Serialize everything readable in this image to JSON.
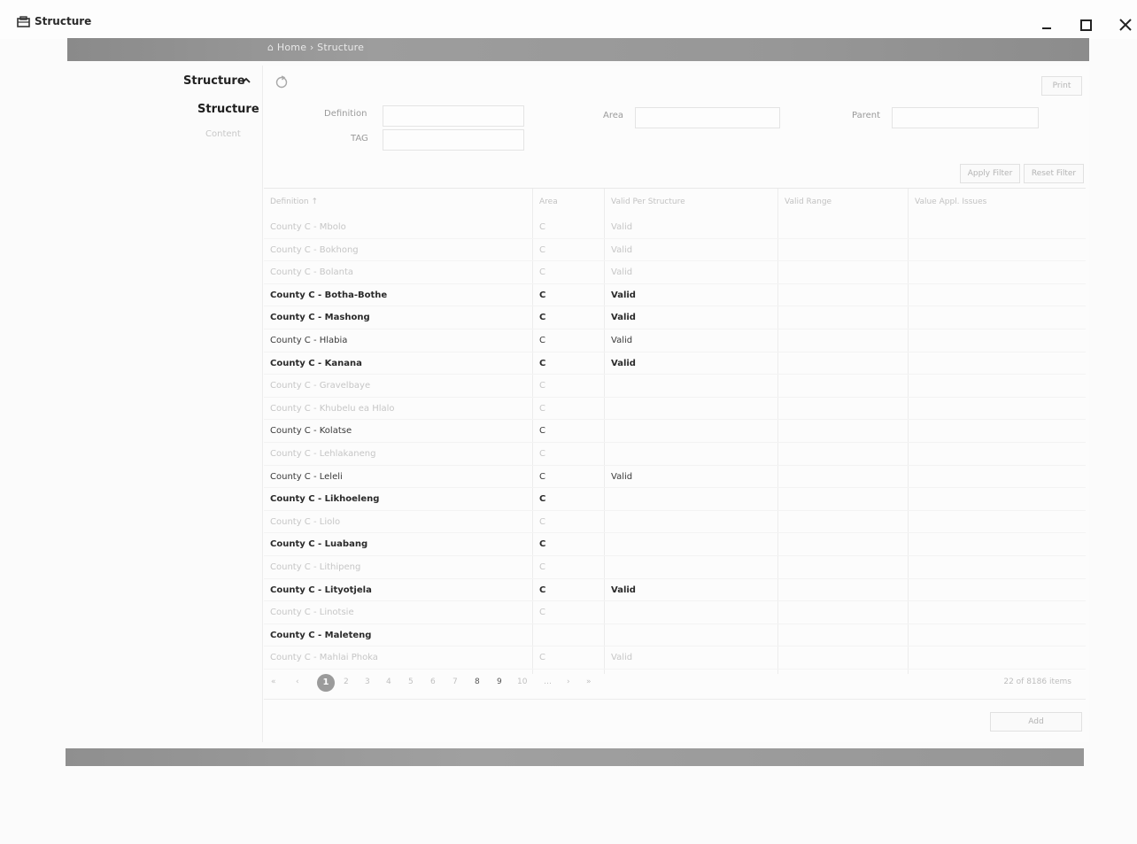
{
  "window": {
    "title": "Structure",
    "minimize_glyph": "–",
    "maximize_glyph": "□",
    "close_glyph": "✕"
  },
  "breadcrumb": "⌂ Home › Structure",
  "sidebar": {
    "section_label": "Structure",
    "items": [
      {
        "label": "Structure",
        "active": true
      },
      {
        "label": "Content",
        "active": false
      }
    ]
  },
  "toolbar": {
    "print_label": "Print",
    "apply_filter_label": "Apply Filter",
    "reset_filter_label": "Reset Filter",
    "add_label": "Add"
  },
  "filters": {
    "definition_label": "Definition",
    "area_label": "Area",
    "parent_label": "Parent",
    "tag_label": "TAG",
    "definition_value": "",
    "area_value": "",
    "parent_value": "",
    "tag_value": ""
  },
  "table": {
    "headers": [
      "Definition ↑",
      "Area",
      "Valid Per Structure",
      "Valid Range",
      "Value Appl. Issues"
    ],
    "rows": [
      {
        "definition": "County C - Mbolo",
        "area": "C",
        "status": "Valid",
        "style": "faded"
      },
      {
        "definition": "County C - Bokhong",
        "area": "C",
        "status": "Valid",
        "style": "faded"
      },
      {
        "definition": "County C - Bolanta",
        "area": "C",
        "status": "Valid",
        "style": "faded"
      },
      {
        "definition": "County C - Botha-Bothe",
        "area": "C",
        "status": "Valid",
        "style": "bold"
      },
      {
        "definition": "County C - Mashong",
        "area": "C",
        "status": "Valid",
        "style": "bold"
      },
      {
        "definition": "County C - Hlabia",
        "area": "C",
        "status": "Valid",
        "style": "normal"
      },
      {
        "definition": "County C - Kanana",
        "area": "C",
        "status": "Valid",
        "style": "bold"
      },
      {
        "definition": "County C - Gravelbaye",
        "area": "C",
        "status": "",
        "style": "faded"
      },
      {
        "definition": "County C - Khubelu ea Hlalo",
        "area": "C",
        "status": "",
        "style": "faded"
      },
      {
        "definition": "County C - Kolatse",
        "area": "C",
        "status": "",
        "style": "normal"
      },
      {
        "definition": "County C - Lehlakaneng",
        "area": "C",
        "status": "",
        "style": "faded"
      },
      {
        "definition": "County C - Leleli",
        "area": "C",
        "status": "Valid",
        "style": "normal"
      },
      {
        "definition": "County C - Likhoeleng",
        "area": "C",
        "status": "",
        "style": "bold"
      },
      {
        "definition": "County C - Liolo",
        "area": "C",
        "status": "",
        "style": "faded"
      },
      {
        "definition": "County C - Luabang",
        "area": "C",
        "status": "",
        "style": "bold"
      },
      {
        "definition": "County C - Lithipeng",
        "area": "C",
        "status": "",
        "style": "faded"
      },
      {
        "definition": "County C - Lityotjela",
        "area": "C",
        "status": "Valid",
        "style": "bold"
      },
      {
        "definition": "County C - Linotsie",
        "area": "C",
        "status": "",
        "style": "faded"
      },
      {
        "definition": "County C - Maleteng",
        "area": "",
        "status": "",
        "style": "bold"
      },
      {
        "definition": "County C - Mahlai Phoka",
        "area": "C",
        "status": "Valid",
        "style": "faded"
      }
    ]
  },
  "pagination": {
    "prev_first": "«",
    "prev": "‹",
    "pages": [
      "1",
      "2",
      "3",
      "4",
      "5",
      "6",
      "7",
      "8",
      "9",
      "10"
    ],
    "ellipsis": "…",
    "next": "›",
    "next_last": "»",
    "current_page": "1",
    "items_info": "22 of 8186 items"
  },
  "colors": {
    "band": "#969696",
    "active_page": "#9b9b9b"
  }
}
